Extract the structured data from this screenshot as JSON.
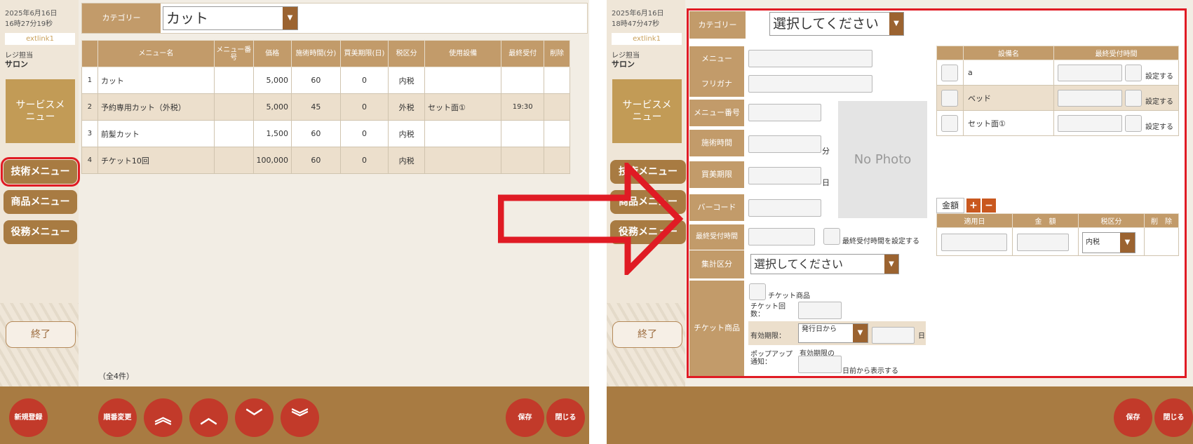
{
  "left": {
    "sidebar": {
      "date": "2025年6月16日",
      "time": "16時27分19秒",
      "link": "extlink1",
      "staff_label": "レジ担当",
      "staff_name": "サロン",
      "service_menu": "サービスメニュー",
      "nav": [
        "技術メニュー",
        "商品メニュー",
        "役務メニュー"
      ],
      "end": "終了"
    },
    "category_label": "カテゴリー",
    "category_value": "カット",
    "table": {
      "headers": [
        "",
        "メニュー名",
        "メニュー番号",
        "価格",
        "施術時間(分)",
        "買美期限(日)",
        "税区分",
        "使用設備",
        "最終受付",
        "削除"
      ],
      "rows": [
        [
          "1",
          "カット",
          "",
          "5,000",
          "60",
          "0",
          "内税",
          "",
          "",
          ""
        ],
        [
          "2",
          "予約専用カット（外税）",
          "",
          "5,000",
          "45",
          "0",
          "外税",
          "セット面①",
          "19:30",
          ""
        ],
        [
          "3",
          "前髪カット",
          "",
          "1,500",
          "60",
          "0",
          "内税",
          "",
          "",
          ""
        ],
        [
          "4",
          "チケット10回",
          "",
          "100,000",
          "60",
          "0",
          "内税",
          "",
          "",
          ""
        ]
      ]
    },
    "count": "（全4件）",
    "buttons": {
      "new": "新規登録",
      "reorder": "順番変更",
      "top": "︽",
      "up": "︿",
      "down": "﹀",
      "bottom": "︾",
      "save": "保存",
      "close": "閉じる"
    }
  },
  "right": {
    "sidebar": {
      "date": "2025年6月16日",
      "time": "18時47分47秒",
      "link": "extlink1",
      "staff_label": "レジ担当",
      "staff_name": "サロン",
      "service_menu": "サービスメニュー",
      "nav": [
        "技術メニュー",
        "商品メニュー",
        "役務メニュー"
      ],
      "end": "終了"
    },
    "category_label": "カテゴリー",
    "category_value": "選択してください",
    "form": {
      "menu": "メニュー",
      "furigana": "フリガナ",
      "menu_no": "メニュー番号",
      "duration": "施術時間",
      "duration_unit": "分",
      "expiry": "買美期限",
      "expiry_unit": "日",
      "barcode": "バーコード",
      "last_accept": "最終受付時間",
      "last_accept_check": "最終受付時間を設定する",
      "agg": "集計区分",
      "agg_value": "選択してください",
      "ticket": "チケット商品",
      "ticket_check": "チケット商品",
      "ticket_count": "チケット回数：",
      "valid": "有効期限：",
      "valid_value": "発行日から",
      "valid_unit": "日",
      "popup": "ポップアップ通知：",
      "popup_text1": "有効期限の",
      "popup_text2": "日前から表示する",
      "no_photo": "No Photo"
    },
    "equipment": {
      "headers": [
        "",
        "設備名",
        "最終受付時間"
      ],
      "rows": [
        "a",
        "ベッド",
        "セット面①"
      ],
      "set": "設定する"
    },
    "price": {
      "tab": "金額",
      "plus": "+",
      "minus": "−",
      "headers": [
        "適用日",
        "金　額",
        "税区分",
        "削　除"
      ],
      "tax_value": "内税"
    },
    "buttons": {
      "save": "保存",
      "close": "閉じる"
    }
  },
  "colors": {
    "accent": "#a87b42",
    "label": "#c29b6a",
    "button": "#c23a2a",
    "highlight": "#e01b24"
  }
}
